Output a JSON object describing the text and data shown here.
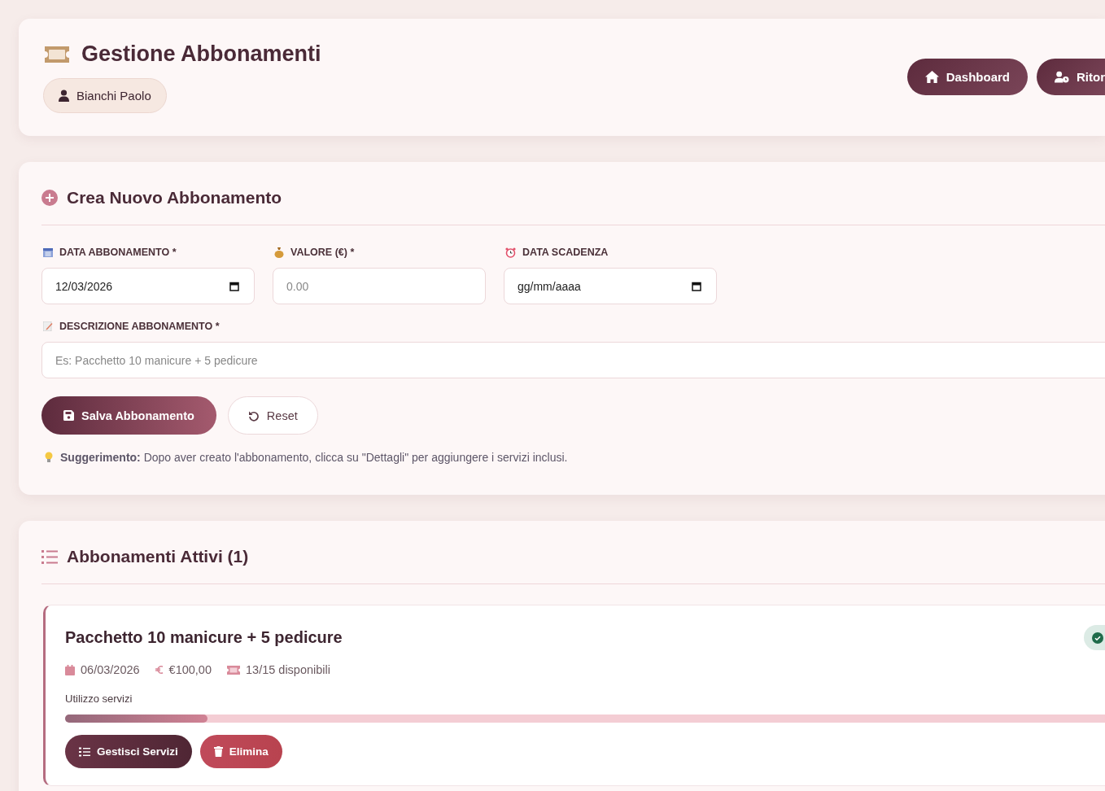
{
  "header": {
    "title": "Gestione Abbonamenti",
    "client": "Bianchi Paolo",
    "buttons": [
      {
        "kind": "home",
        "label": "Dashboard"
      },
      {
        "kind": "user",
        "label": "Ritor"
      }
    ]
  },
  "create_form": {
    "title": "Crea Nuovo Abbonamento",
    "fields": [
      {
        "kind": "date",
        "label": "DATA ABBONAMENTO *",
        "value": "12/03/2026"
      },
      {
        "kind": "money",
        "label": "VALORE (€) *",
        "placeholder": "0.00"
      },
      {
        "kind": "alarm",
        "label": "DATA SCADENZA",
        "value": "gg/mm/aaaa"
      }
    ],
    "description": {
      "label": "DESCRIZIONE ABBONAMENTO *",
      "placeholder": "Es: Pacchetto 10 manicure + 5 pedicure"
    },
    "buttons": [
      {
        "kind": "primary",
        "label": "Salva Abbonamento"
      },
      {
        "kind": "secondary",
        "label": "Reset"
      }
    ],
    "hint": "**Suggerimento:** Dopo aver creato l'abbonamento, clicca su \"Dettagli\" per aggiungere i servizi inclusi."
  },
  "active_list": {
    "title": "Abbonamenti Attivi (1)",
    "items": [
      {
        "name": "Pacchetto 10 manicure + 5 pedicure",
        "date": "06/03/2026",
        "value": "€100,00",
        "available": "13/15 disponibili",
        "active": true,
        "usage_label": "Utilizzo servizi",
        "level": 0.133,
        "buttons": [
          {
            "kind": "manage",
            "label": "Gestisci Servizi"
          },
          {
            "kind": "delete",
            "label": "Elimina"
          }
        ]
      }
    ]
  }
}
